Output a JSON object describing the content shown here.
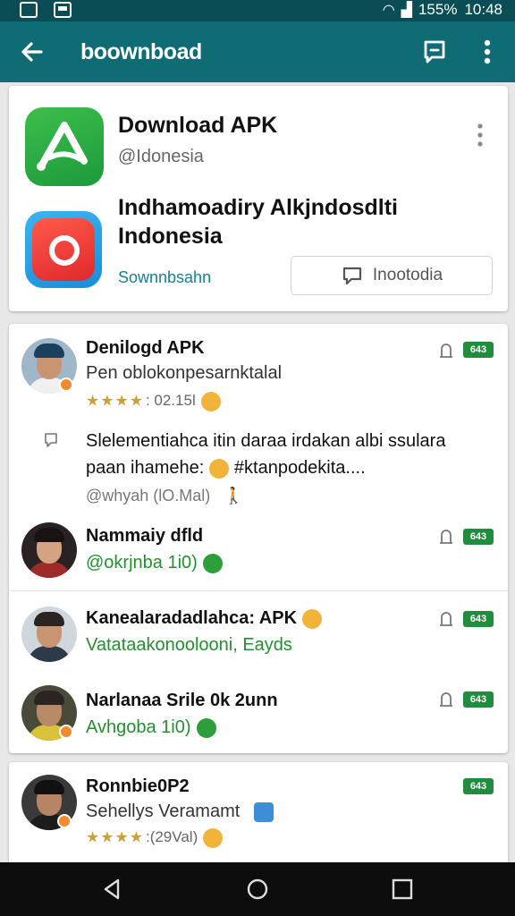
{
  "status_bar": {
    "battery": "155%",
    "time": "10:48",
    "icons": [
      "notification-icon",
      "image-icon",
      "wifi-icon",
      "signal-icon",
      "battery-icon"
    ]
  },
  "app_bar": {
    "title": "boownboad",
    "icons": [
      "back-arrow-icon",
      "message-icon",
      "more-vert-icon"
    ]
  },
  "card1": {
    "title": "Download APK",
    "handle": "@Idonesia",
    "title2": "Indhamoadiry Alkjndosdlti Indonesia",
    "link": "Sownnbsahn",
    "button_label": "Inootodia"
  },
  "rows": [
    {
      "name": "Denilogd APK",
      "subtitle": "Pen oblokonpesarnktalal",
      "stars": "★★★★",
      "rating_text": ": 02.15l",
      "badge": "643",
      "comment": "Slelementiahca itin daraa irdakan albi ssulara paan ihamehe:",
      "comment_tail": "#ktanpodekita....",
      "meta": "@whyah (lO.Mal)"
    },
    {
      "name": "Nammaiy dfld",
      "subtitle": "@okrjnba 1i0)",
      "badge": "643"
    },
    {
      "name": "Kanealaradadlahca: APK",
      "subtitle": "Vatataakonoolooni, Eayds",
      "badge": "643"
    },
    {
      "name": "Narlanaa Srile 0k 2unn",
      "subtitle": "Avhgoba 1i0)",
      "badge": "643"
    },
    {
      "name": "Ronnbie0P2",
      "subtitle": "Sehellys Veramamt",
      "stars": "★★★★",
      "rating_text": ":(29Val)",
      "badge": "643"
    }
  ],
  "colors": {
    "app_bar": "#0f6b74",
    "status_bar": "#0a4d55",
    "accent_green": "#1e8e3c",
    "link": "#178190"
  }
}
